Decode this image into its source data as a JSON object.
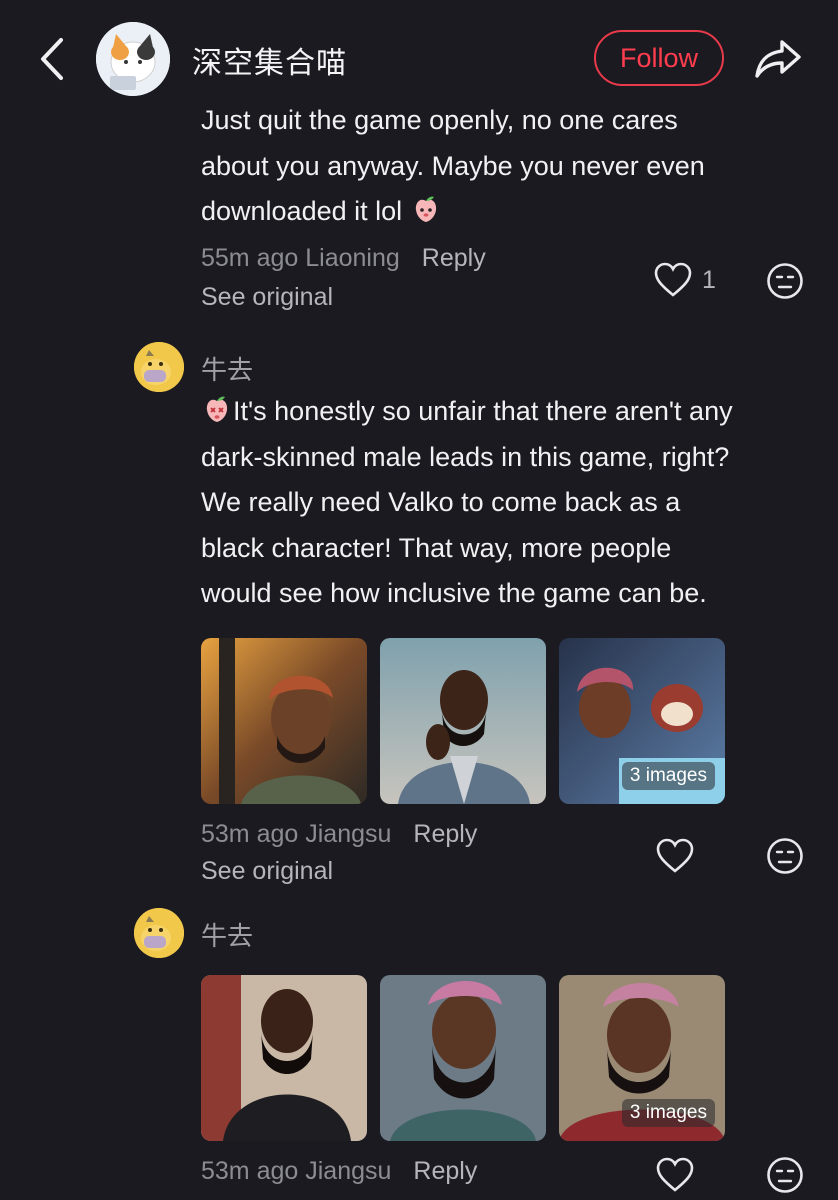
{
  "header": {
    "author_name": "深空集合喵",
    "follow_label": "Follow"
  },
  "comments": [
    {
      "text_lines": [
        "Just quit the game openly, no one cares",
        "about you anyway. Maybe you never even",
        "downloaded it lol"
      ],
      "meta": "55m ago Liaoning",
      "reply_label": "Reply",
      "see_original_label": "See original",
      "like_count": "1"
    },
    {
      "username": "牛去",
      "text_lines": [
        "It's honestly so unfair that there aren't any",
        "dark-skinned male leads in this game, right?",
        "We really need Valko to come back as a",
        "black character! That way, more people",
        "would see how inclusive the game can be."
      ],
      "images_badge": "3 images",
      "meta": "53m ago Jiangsu",
      "reply_label": "Reply",
      "see_original_label": "See original"
    },
    {
      "username": "牛去",
      "images_badge": "3 images",
      "meta": "53m ago Jiangsu",
      "reply_label": "Reply"
    }
  ],
  "icons": {
    "back": "chevron-left-icon",
    "share": "share-arrow-icon",
    "like": "heart-icon",
    "react": "emoji-face-icon",
    "inline_emoji": "peach-emoji-icon"
  },
  "colors": {
    "background": "#1b1a20",
    "follow_accent": "#ff3d4f",
    "muted_text": "#8c8c93"
  }
}
